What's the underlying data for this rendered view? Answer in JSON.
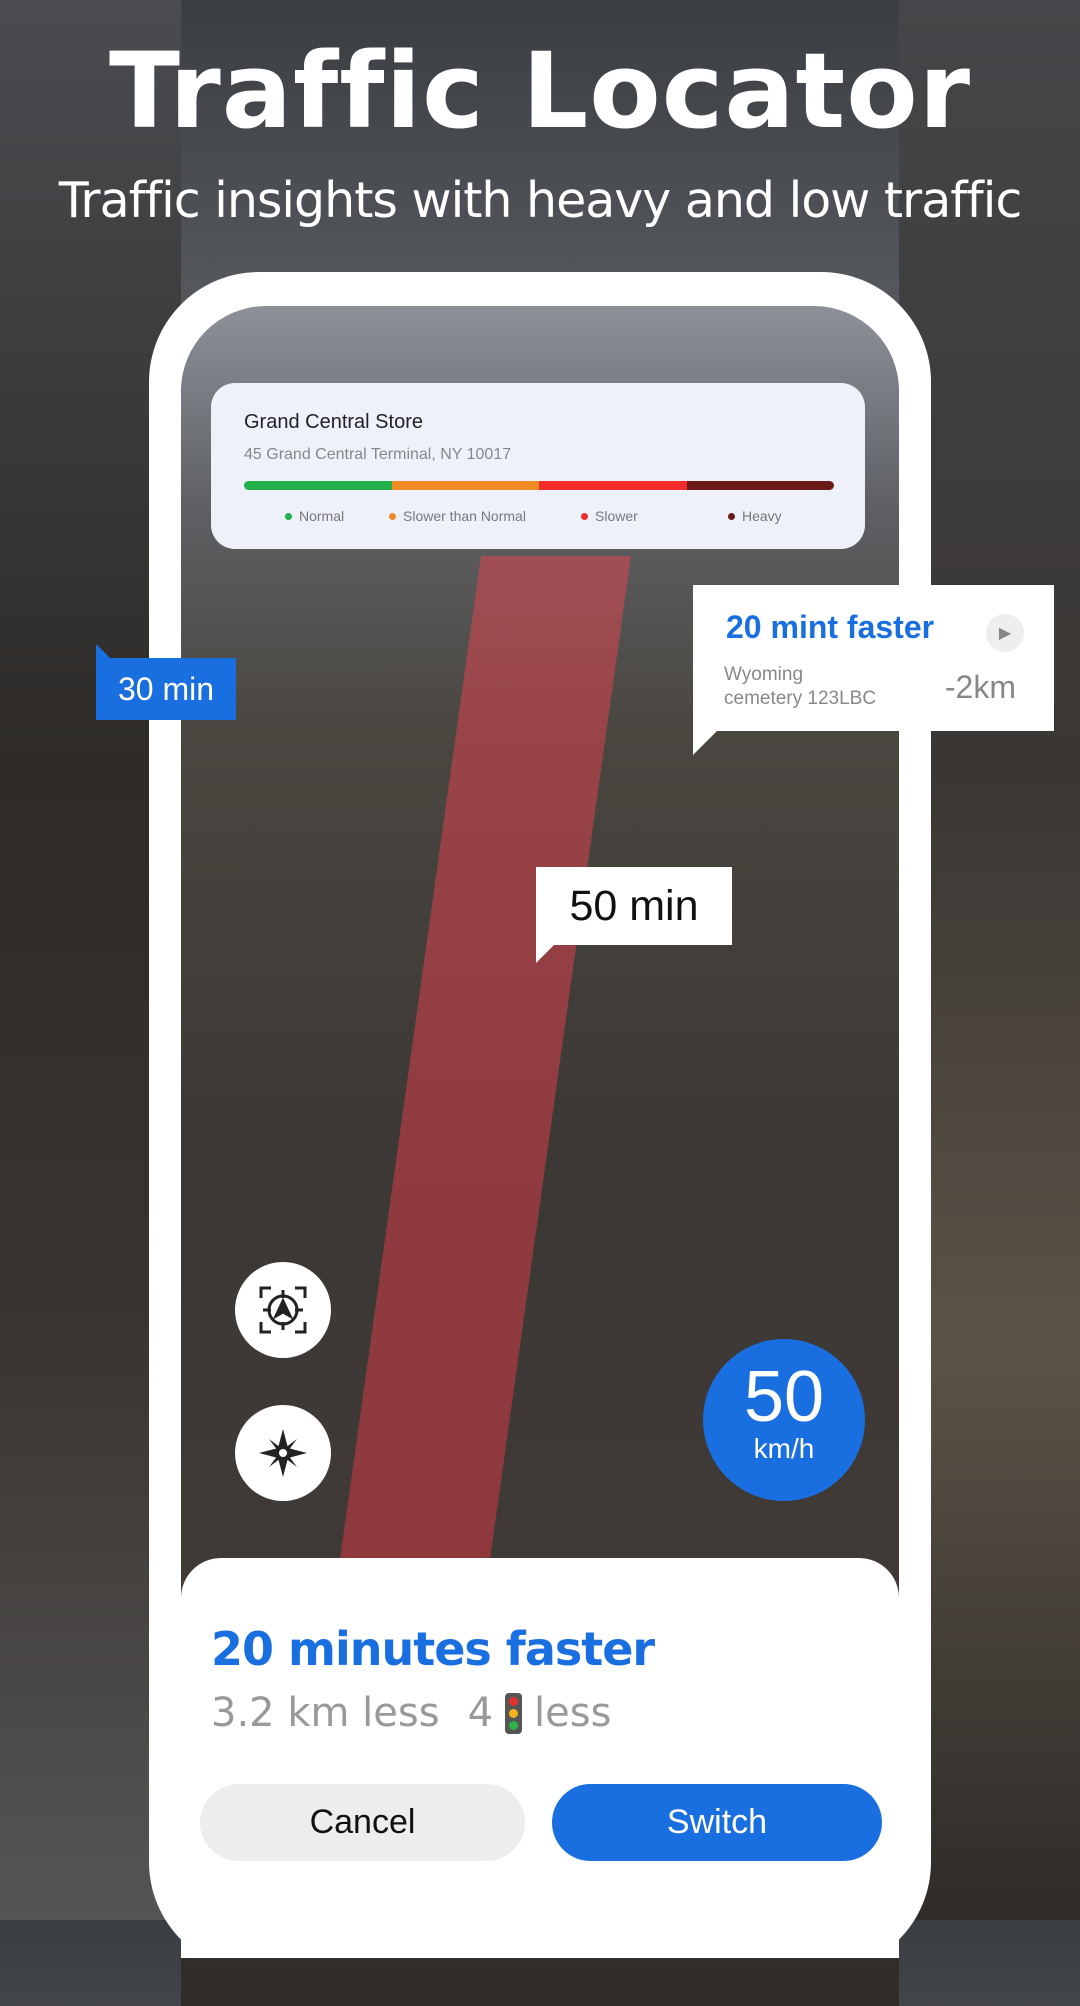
{
  "header": {
    "title": "Traffic Locator",
    "subtitle": "Traffic insights with heavy and low traffic"
  },
  "location_card": {
    "name": "Grand Central Store",
    "address": "45 Grand Central Terminal, NY 10017",
    "legend": [
      {
        "label": "Normal",
        "color": "#22b04a"
      },
      {
        "label": "Slower than Normal",
        "color": "#f08a24"
      },
      {
        "label": "Slower",
        "color": "#f22b2b"
      },
      {
        "label": "Heavy",
        "color": "#6b1a1a"
      }
    ]
  },
  "tags": {
    "left": "30 min",
    "center": "50 min"
  },
  "callout": {
    "title": "20 mint faster",
    "place": "Wyoming cemetery 123LBC",
    "place_line1": "Wyoming",
    "place_line2": "cemetery 123LBC",
    "distance": "-2km"
  },
  "speed": {
    "value": "50",
    "unit": "km/h"
  },
  "icons": {
    "locate": "locate-icon",
    "compass": "compass-icon",
    "play": "play-icon",
    "traffic_light": "traffic-light-icon"
  },
  "sheet": {
    "headline": "20 minutes faster",
    "distance_less": "3.2 km less",
    "lights_count": "4",
    "lights_less": "less",
    "cancel": "Cancel",
    "switch": "Switch"
  },
  "colors": {
    "accent": "#1a6fe0"
  }
}
